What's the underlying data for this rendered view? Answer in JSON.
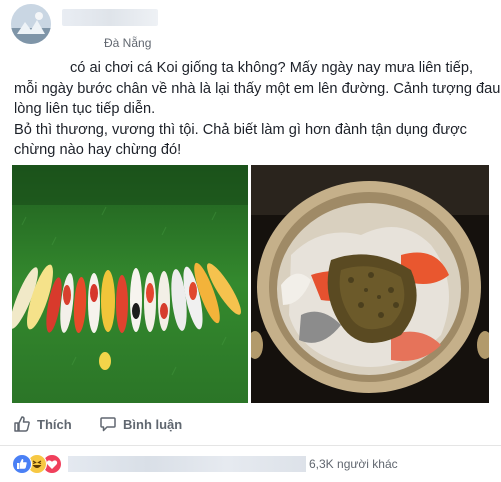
{
  "post": {
    "location": "Đà Nẵng",
    "text_lines": [
      "có ai chơi cá Koi giống ta   không? Mấy ngày nay mưa liên tiếp,",
      "mỗi ngày bước chân về nhà là lại thấy một em lên đường. Cảnh tượng đau",
      "lòng liên tục tiếp diễn.",
      "Bỏ thì thương, vương thì tội. Chả biết làm gì hơn đành tận dụng được",
      "chừng nào hay chừng đó!"
    ]
  },
  "actions": {
    "like_label": "Thích",
    "comment_label": "Bình luận"
  },
  "reactions": {
    "types": [
      "like",
      "haha",
      "love"
    ],
    "count_text": "6,3K người khác"
  },
  "colors": {
    "like": "#4a80f5",
    "haha": "#f7c843",
    "love": "#f0405c",
    "secondary_text": "#616770"
  }
}
